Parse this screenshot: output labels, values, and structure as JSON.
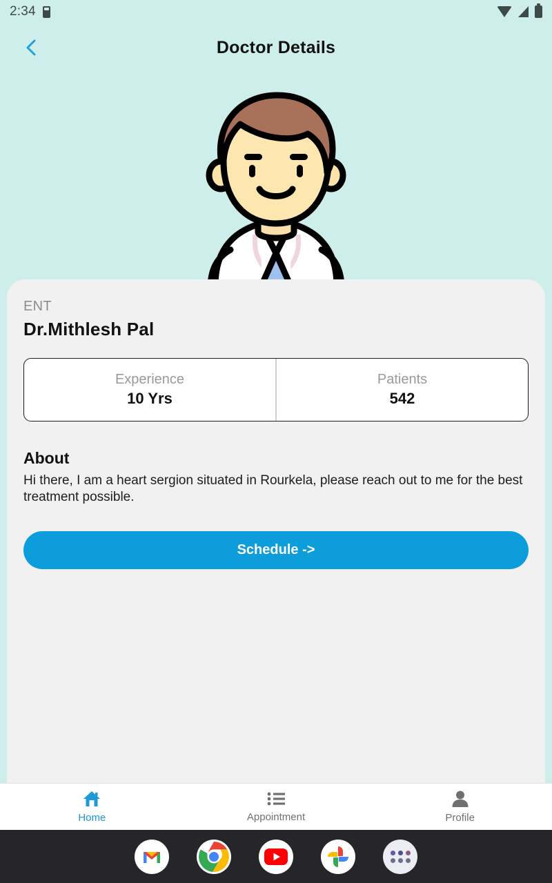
{
  "status_bar": {
    "time": "2:34",
    "icons": [
      "sim-card-icon",
      "wifi-icon",
      "cellular-signal-icon",
      "battery-icon"
    ]
  },
  "app_bar": {
    "back_icon": "chevron-left-icon",
    "title": "Doctor Details"
  },
  "hero": {
    "illustration": "doctor-avatar-illustration",
    "background_color": "#cdeeea"
  },
  "doctor": {
    "specialty": "ENT",
    "name": "Dr.Mithlesh Pal",
    "stats": [
      {
        "label": "Experience",
        "value": "10 Yrs"
      },
      {
        "label": "Patients",
        "value": "542"
      }
    ]
  },
  "about": {
    "title": "About",
    "text": "Hi there, I am a heart sergion situated in Rourkela, please reach out to me for the best treatment possible."
  },
  "actions": {
    "schedule_label": "Schedule ->",
    "schedule_color": "#0d9ddb"
  },
  "bottom_nav": {
    "items": [
      {
        "label": "Home",
        "icon": "home-icon",
        "active": true
      },
      {
        "label": "Appointment",
        "icon": "list-icon",
        "active": false
      },
      {
        "label": "Profile",
        "icon": "person-icon",
        "active": false
      }
    ],
    "active_color": "#2196d3",
    "inactive_color": "#6f6f6f"
  },
  "dock": {
    "apps": [
      {
        "name": "gmail-icon"
      },
      {
        "name": "chrome-icon"
      },
      {
        "name": "youtube-icon"
      },
      {
        "name": "google-photos-icon"
      },
      {
        "name": "app-drawer-icon"
      }
    ]
  }
}
